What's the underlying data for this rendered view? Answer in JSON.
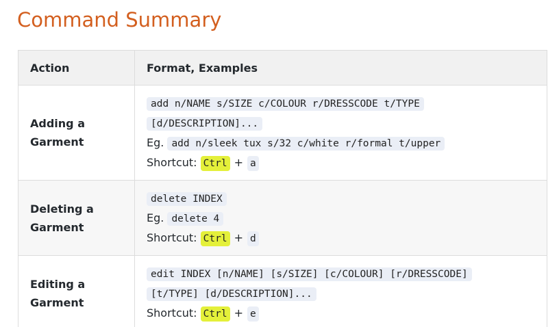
{
  "heading": "Command Summary",
  "table": {
    "headers": [
      "Action",
      "Format, Examples"
    ],
    "eg_label": "Eg.",
    "shortcut_label": "Shortcut:",
    "plus": "+",
    "rows": [
      {
        "action_lines": [
          "Adding a",
          "Garment"
        ],
        "format_lines": [
          "add n/NAME s/SIZE c/COLOUR r/DRESSCODE t/TYPE",
          "[d/DESCRIPTION]..."
        ],
        "example": "add n/sleek tux s/32 c/white r/formal t/upper",
        "modifier_key": "Ctrl",
        "key": "a"
      },
      {
        "action_lines": [
          "Deleting a",
          "Garment"
        ],
        "format_lines": [
          "delete INDEX"
        ],
        "example": "delete 4",
        "modifier_key": "Ctrl",
        "key": "d"
      },
      {
        "action_lines": [
          "Editing a",
          "Garment"
        ],
        "format_lines": [
          "edit INDEX [n/NAME] [s/SIZE] [c/COLOUR] [r/DRESSCODE]",
          "[t/TYPE] [d/DESCRIPTION]..."
        ],
        "modifier_key": "Ctrl",
        "key": "e"
      }
    ]
  }
}
